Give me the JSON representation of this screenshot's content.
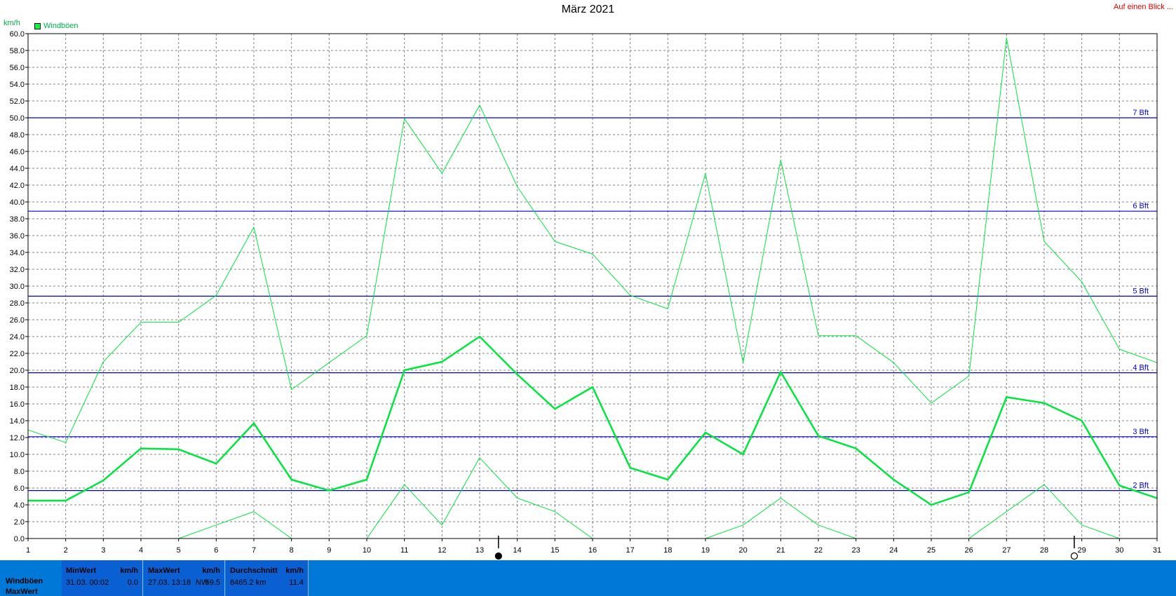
{
  "title": "März 2021",
  "link_label": "Auf einen Blick ...",
  "unit_label": "km/h",
  "legend": {
    "label": "Windböen",
    "color": "#00ff40"
  },
  "chart_data": {
    "type": "line",
    "title": "März 2021",
    "ylabel": "km/h",
    "xlim": [
      1,
      31
    ],
    "ylim": [
      0,
      60
    ],
    "grid": true,
    "legend_position": "top-left",
    "x": [
      1,
      2,
      3,
      4,
      5,
      6,
      7,
      8,
      9,
      10,
      11,
      12,
      13,
      14,
      15,
      16,
      17,
      18,
      19,
      20,
      21,
      22,
      23,
      24,
      25,
      26,
      27,
      28,
      29,
      30,
      31
    ],
    "x_ticks": [
      "1",
      "2",
      "3",
      "4",
      "5",
      "6",
      "7",
      "8",
      "9",
      "10",
      "11",
      "12",
      "13",
      "14",
      "15",
      "16",
      "17",
      "18",
      "19",
      "20",
      "21",
      "22",
      "23",
      "24",
      "25",
      "26",
      "27",
      "28",
      "29",
      "30",
      "31"
    ],
    "y_ticks": [
      "0.0",
      "2.0",
      "4.0",
      "6.0",
      "8.0",
      "10.0",
      "12.0",
      "14.0",
      "16.0",
      "18.0",
      "20.0",
      "22.0",
      "24.0",
      "26.0",
      "28.0",
      "30.0",
      "32.0",
      "34.0",
      "36.0",
      "38.0",
      "40.0",
      "42.0",
      "44.0",
      "46.0",
      "48.0",
      "50.0",
      "52.0",
      "54.0",
      "56.0",
      "58.0",
      "60.0"
    ],
    "series": [
      {
        "name": "Windböen",
        "style": "average",
        "color": "#00e63c",
        "values": [
          4.5,
          4.5,
          6.9,
          10.7,
          10.6,
          8.9,
          13.7,
          7.0,
          5.7,
          7.0,
          20.0,
          21.0,
          24.0,
          19.5,
          15.4,
          18.0,
          8.4,
          7.0,
          12.6,
          10.0,
          19.8,
          12.2,
          10.7,
          7.0,
          4.0,
          5.5,
          16.8,
          16.1,
          14.0,
          6.3,
          4.8
        ]
      },
      {
        "name": "",
        "style": "max",
        "color": "#00e63c",
        "values": [
          12.9,
          11.4,
          21.0,
          25.7,
          25.7,
          28.9,
          37.0,
          17.7,
          20.9,
          24.1,
          49.9,
          43.4,
          51.5,
          41.8,
          35.3,
          33.8,
          28.9,
          27.3,
          43.4,
          20.9,
          45.0,
          24.1,
          24.1,
          20.9,
          16.1,
          19.3,
          59.5,
          35.3,
          30.5,
          22.5,
          20.9
        ]
      },
      {
        "name": "",
        "style": "min",
        "color": "#00e63c",
        "values": [
          null,
          null,
          null,
          null,
          0.0,
          1.6,
          3.2,
          0.0,
          null,
          0.0,
          6.4,
          1.6,
          9.6,
          4.8,
          3.2,
          0.0,
          null,
          null,
          0.0,
          1.6,
          4.8,
          1.6,
          0.0,
          null,
          null,
          0.0,
          3.2,
          6.4,
          1.6,
          0.0,
          null
        ]
      }
    ],
    "reference_lines": [
      {
        "label": "2 Bft",
        "value": 5.7
      },
      {
        "label": "3 Bft",
        "value": 12.1
      },
      {
        "label": "4 Bft",
        "value": 19.7
      },
      {
        "label": "5 Bft",
        "value": 28.8
      },
      {
        "label": "6 Bft",
        "value": 38.9
      },
      {
        "label": "7 Bft",
        "value": 50.0
      }
    ],
    "moon_markers": [
      {
        "phase": "new-moon",
        "day": 13.5
      },
      {
        "phase": "full-moon",
        "day": 28.8
      }
    ]
  },
  "stats": {
    "row_label_1": "Windböen",
    "row_label_2": "MaxWert",
    "min": {
      "header": "MinWert",
      "unit": "km/h",
      "date": "31.03.  00:02",
      "value": "0.0"
    },
    "max": {
      "header": "MaxWert",
      "unit": "km/h",
      "date": "27.03.  13:18",
      "dir": "NW",
      "value": "59.5"
    },
    "avg": {
      "header": "Durchschnitt",
      "unit": "km/h",
      "distance": "8465.2 km",
      "value": "11.4"
    }
  }
}
